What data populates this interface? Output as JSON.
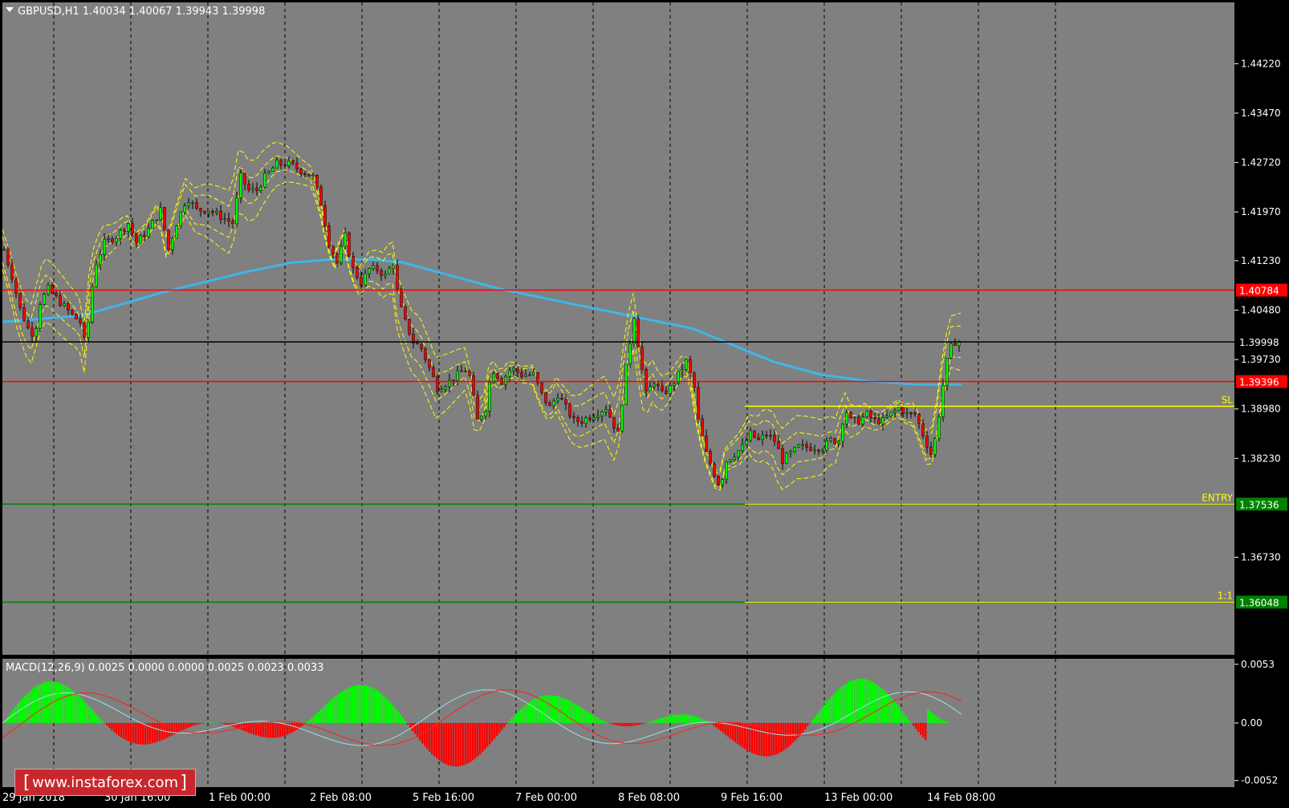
{
  "symbol_header": "GBPUSD,H1  1.40034 1.40067 1.39943 1.39998",
  "macd_header": "MACD(12,26,9) 0.0025 0.0000 0.0000 0.0025 0.0023 0.0033",
  "watermark": {
    "open": "[",
    "text": "www.instaforex.com",
    "close": "]"
  },
  "colors": {
    "background": "#808080",
    "grid": "#000000",
    "bull": "#00ff00",
    "bear": "#ff0000",
    "bands": "#ffff00",
    "ma": "#3fb6e8",
    "macd_up": "#00ff00",
    "macd_down": "#ff00ff"
  },
  "chart_data": [
    {
      "type": "candlestick",
      "title": "GBPUSD,H1",
      "ohlc_last": {
        "open": 1.40034,
        "high": 1.40067,
        "low": 1.39943,
        "close": 1.39998
      },
      "ylim": [
        1.3525,
        1.4515
      ],
      "y_ticks": [
        "1.44220",
        "1.43470",
        "1.42720",
        "1.41970",
        "1.41230",
        "1.40480",
        "1.39730",
        "1.38980",
        "1.38230",
        "1.36730"
      ],
      "x_tick_labels": [
        "29 Jan 2018",
        "30 Jan 16:00",
        "1 Feb 00:00",
        "2 Feb 08:00",
        "5 Feb 16:00",
        "7 Feb 00:00",
        "8 Feb 08:00",
        "9 Feb 16:00",
        "13 Feb 00:00",
        "14 Feb 08:00"
      ],
      "price_path": [
        [
          0,
          1.414
        ],
        [
          10,
          1.41
        ],
        [
          20,
          1.405
        ],
        [
          30,
          1.402
        ],
        [
          38,
          1.401
        ],
        [
          45,
          1.406
        ],
        [
          55,
          1.408
        ],
        [
          70,
          1.406
        ],
        [
          85,
          1.404
        ],
        [
          95,
          1.403
        ],
        [
          102,
          1.399
        ],
        [
          108,
          1.407
        ],
        [
          115,
          1.412
        ],
        [
          125,
          1.415
        ],
        [
          140,
          1.416
        ],
        [
          155,
          1.418
        ],
        [
          165,
          1.415
        ],
        [
          180,
          1.417
        ],
        [
          195,
          1.42
        ],
        [
          205,
          1.414
        ],
        [
          215,
          1.418
        ],
        [
          228,
          1.422
        ],
        [
          240,
          1.42
        ],
        [
          255,
          1.42
        ],
        [
          270,
          1.419
        ],
        [
          285,
          1.418
        ],
        [
          295,
          1.425
        ],
        [
          305,
          1.423
        ],
        [
          315,
          1.423
        ],
        [
          325,
          1.425
        ],
        [
          340,
          1.427
        ],
        [
          355,
          1.427
        ],
        [
          370,
          1.426
        ],
        [
          385,
          1.425
        ],
        [
          395,
          1.421
        ],
        [
          405,
          1.415
        ],
        [
          415,
          1.412
        ],
        [
          425,
          1.416
        ],
        [
          435,
          1.411
        ],
        [
          445,
          1.409
        ],
        [
          455,
          1.411
        ],
        [
          465,
          1.411
        ],
        [
          475,
          1.41
        ],
        [
          485,
          1.412
        ],
        [
          492,
          1.406
        ],
        [
          500,
          1.403
        ],
        [
          510,
          1.4
        ],
        [
          520,
          1.399
        ],
        [
          530,
          1.396
        ],
        [
          540,
          1.393
        ],
        [
          555,
          1.394
        ],
        [
          565,
          1.395
        ],
        [
          578,
          1.396
        ],
        [
          590,
          1.388
        ],
        [
          600,
          1.39
        ],
        [
          608,
          1.396
        ],
        [
          620,
          1.394
        ],
        [
          632,
          1.396
        ],
        [
          645,
          1.395
        ],
        [
          660,
          1.395
        ],
        [
          670,
          1.392
        ],
        [
          680,
          1.39
        ],
        [
          690,
          1.392
        ],
        [
          700,
          1.39
        ],
        [
          710,
          1.388
        ],
        [
          720,
          1.388
        ],
        [
          735,
          1.389
        ],
        [
          750,
          1.39
        ],
        [
          765,
          1.386
        ],
        [
          775,
          1.396
        ],
        [
          785,
          1.404
        ],
        [
          792,
          1.398
        ],
        [
          800,
          1.392
        ],
        [
          810,
          1.394
        ],
        [
          820,
          1.392
        ],
        [
          830,
          1.393
        ],
        [
          840,
          1.395
        ],
        [
          850,
          1.397
        ],
        [
          860,
          1.393
        ],
        [
          865,
          1.388
        ],
        [
          875,
          1.383
        ],
        [
          885,
          1.38
        ],
        [
          892,
          1.378
        ],
        [
          900,
          1.382
        ],
        [
          910,
          1.383
        ],
        [
          920,
          1.384
        ],
        [
          930,
          1.386
        ],
        [
          940,
          1.385
        ],
        [
          950,
          1.386
        ],
        [
          960,
          1.385
        ],
        [
          970,
          1.382
        ],
        [
          980,
          1.383
        ],
        [
          990,
          1.384
        ],
        [
          1000,
          1.384
        ],
        [
          1010,
          1.384
        ],
        [
          1020,
          1.384
        ],
        [
          1030,
          1.385
        ],
        [
          1040,
          1.385
        ],
        [
          1048,
          1.39
        ],
        [
          1055,
          1.388
        ],
        [
          1065,
          1.388
        ],
        [
          1075,
          1.389
        ],
        [
          1085,
          1.388
        ],
        [
          1095,
          1.388
        ],
        [
          1105,
          1.389
        ],
        [
          1115,
          1.39
        ],
        [
          1125,
          1.389
        ],
        [
          1135,
          1.389
        ],
        [
          1145,
          1.386
        ],
        [
          1155,
          1.383
        ],
        [
          1162,
          1.386
        ],
        [
          1168,
          1.392
        ],
        [
          1175,
          1.397
        ],
        [
          1182,
          1.4
        ],
        [
          1190,
          1.4
        ]
      ],
      "ma_path": [
        [
          0,
          1.403
        ],
        [
          100,
          1.404
        ],
        [
          200,
          1.4075
        ],
        [
          300,
          1.4105
        ],
        [
          360,
          1.412
        ],
        [
          410,
          1.4125
        ],
        [
          460,
          1.4125
        ],
        [
          500,
          1.412
        ],
        [
          560,
          1.41
        ],
        [
          620,
          1.408
        ],
        [
          700,
          1.406
        ],
        [
          780,
          1.404
        ],
        [
          860,
          1.402
        ],
        [
          900,
          1.4
        ],
        [
          960,
          1.397
        ],
        [
          1020,
          1.395
        ],
        [
          1080,
          1.394
        ],
        [
          1140,
          1.3935
        ],
        [
          1195,
          1.3935
        ]
      ],
      "horizontal_levels": [
        {
          "price": 1.40784,
          "label": "1.40784",
          "color": "#ff0000",
          "text": ""
        },
        {
          "price": 1.39998,
          "label": "1.39998",
          "color": "#000000",
          "text": ""
        },
        {
          "price": 1.39396,
          "label": "1.39396",
          "color": "#ff0000",
          "text": ""
        },
        {
          "price": 1.3902,
          "label": "",
          "color": "#ffff00",
          "text": "SL"
        },
        {
          "price": 1.37536,
          "label": "1.37536",
          "color": "#008000",
          "text": "ENTRY"
        },
        {
          "price": 1.36048,
          "label": "1.36048",
          "color": "#008000",
          "text": "1:1"
        }
      ]
    },
    {
      "type": "macd",
      "title": "MACD(12,26,9)",
      "values": {
        "macd": 0.0025,
        "signal": 0.0023,
        "hist": 0.0033
      },
      "ylim": [
        -0.0058,
        0.0058
      ],
      "y_ticks": [
        "0.0053",
        "0.00",
        "-0.0052"
      ]
    }
  ]
}
